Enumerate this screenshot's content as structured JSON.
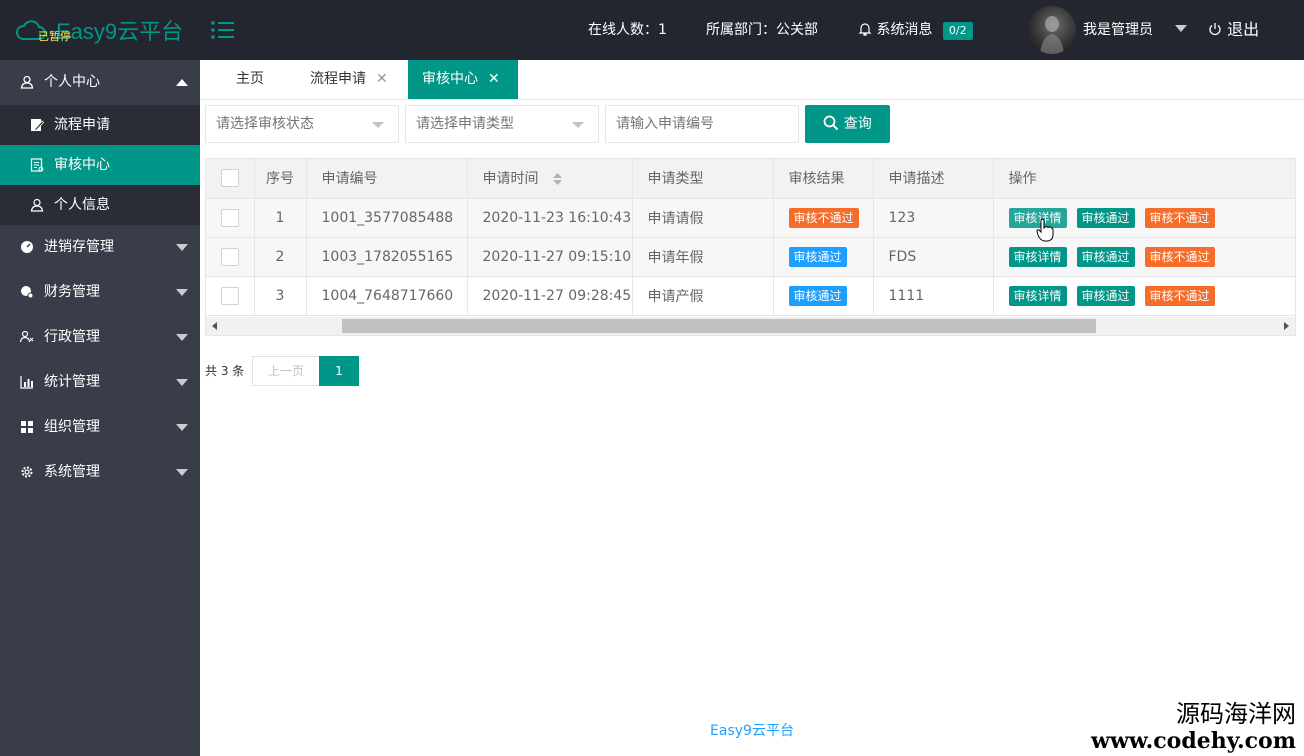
{
  "header": {
    "app_title": "Easy9云平台",
    "paused_label": "已暂停",
    "online_label": "在线人数：1",
    "department_label": "所属部门：公关部",
    "messages_label": "系统消息",
    "messages_badge": "0/2",
    "user_name": "我是管理员",
    "logout_label": "退出"
  },
  "sidebar": {
    "items": [
      {
        "label": "个人中心",
        "icon": "user-icon",
        "expanded": true,
        "children": [
          {
            "label": "流程申请",
            "icon": "edit-icon"
          },
          {
            "label": "审核中心",
            "icon": "document-icon",
            "active": true
          },
          {
            "label": "个人信息",
            "icon": "person-icon"
          }
        ]
      },
      {
        "label": "进销存管理",
        "icon": "dashboard-icon"
      },
      {
        "label": "财务管理",
        "icon": "finance-icon"
      },
      {
        "label": "行政管理",
        "icon": "people-icon"
      },
      {
        "label": "统计管理",
        "icon": "chart-icon"
      },
      {
        "label": "组织管理",
        "icon": "grid-icon"
      },
      {
        "label": "系统管理",
        "icon": "gear-icon"
      }
    ]
  },
  "tabs": [
    {
      "label": "主页"
    },
    {
      "label": "流程申请",
      "close": "✕"
    },
    {
      "label": "审核中心",
      "close": "✕",
      "active": true
    }
  ],
  "search": {
    "status_placeholder": "请选择审核状态",
    "type_placeholder": "请选择申请类型",
    "number_placeholder": "请输入申请编号",
    "query_label": "查询"
  },
  "table": {
    "columns": [
      "序号",
      "申请编号",
      "申请时间",
      "申请类型",
      "审核结果",
      "申请描述",
      "操作"
    ],
    "rows": [
      {
        "index": "1",
        "number": "1001_3577085488",
        "time": "2020-11-23 16:10:43",
        "type": "申请请假",
        "result": "审核不通过",
        "result_kind": "rejected",
        "desc": "123"
      },
      {
        "index": "2",
        "number": "1003_1782055165",
        "time": "2020-11-27 09:15:10",
        "type": "申请年假",
        "result": "审核通过",
        "result_kind": "approved",
        "desc": "FDS"
      },
      {
        "index": "3",
        "number": "1004_7648717660",
        "time": "2020-11-27 09:28:45",
        "type": "申请产假",
        "result": "审核通过",
        "result_kind": "approved",
        "desc": "1111"
      }
    ],
    "actions": {
      "detail": "审核详情",
      "approve": "审核通过",
      "reject": "审核不通过"
    }
  },
  "pager": {
    "total": "共 3 条",
    "prev": "上一页",
    "current": "1"
  },
  "footer": "Easy9云平台",
  "watermark": {
    "line1": "源码海洋网",
    "line2": "www.codehy.com"
  },
  "colors": {
    "accent": "#009688",
    "sidebar": "#393d49",
    "header": "#23262e",
    "danger": "#f56c2b",
    "info": "#1e9fff"
  }
}
